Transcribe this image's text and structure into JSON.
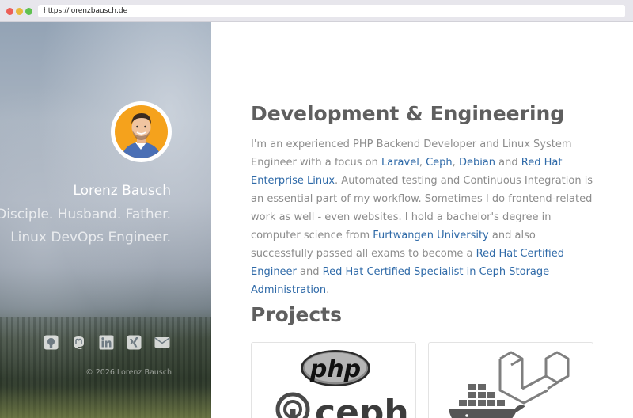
{
  "browser": {
    "url": "https://lorenzbausch.de"
  },
  "profile": {
    "name": "Lorenz Bausch",
    "tagline_line1": "Disciple. Husband. Father.",
    "tagline_line2": "Linux DevOps Engineer.",
    "avatar_bg_color": "#f5a21c"
  },
  "social": [
    {
      "icon": "github-icon"
    },
    {
      "icon": "mastodon-icon"
    },
    {
      "icon": "linkedin-icon"
    },
    {
      "icon": "xing-icon"
    },
    {
      "icon": "mail-icon"
    }
  ],
  "footer": {
    "copyright": "© 2026 Lorenz Bausch"
  },
  "sections": {
    "development": {
      "title": "Development & Engineering",
      "text_1": "I'm an experienced PHP Backend Developer and Linux System Engineer with a focus on ",
      "link_laravel": "Laravel",
      "sep_1": ", ",
      "link_ceph": "Ceph",
      "sep_2": ", ",
      "link_debian": "Debian",
      "sep_3": " and ",
      "link_rhel": "Red Hat Enterprise Linux",
      "text_2": ". Automated testing and Continuous Integration is an essential part of my workflow. Sometimes I do frontend-related work as well - even websites. I hold a bachelor's degree in computer science from ",
      "link_furtwangen": "Furtwangen University",
      "text_3": " and also successfully passed all exams to become a ",
      "link_rhce": "Red Hat Certified Engineer",
      "sep_4": " and ",
      "link_rhcs": "Red Hat Certified Specialist in Ceph Storage Administration",
      "text_4": "."
    },
    "projects": {
      "title": "Projects",
      "cards": [
        {
          "logos": [
            "php-logo",
            "ceph-logo"
          ],
          "php_label": "php",
          "ceph_label": "ceph"
        },
        {
          "logos": [
            "docker-logo",
            "laravel-logo"
          ]
        }
      ]
    }
  },
  "colors": {
    "link": "#2f6aa8",
    "body_text": "#8c8c8c",
    "heading": "#5f5f5f",
    "ceph": "#3c3c3c",
    "php_oval": "#8892bf",
    "docker": "#555555",
    "laravel": "#7f7f7f"
  }
}
